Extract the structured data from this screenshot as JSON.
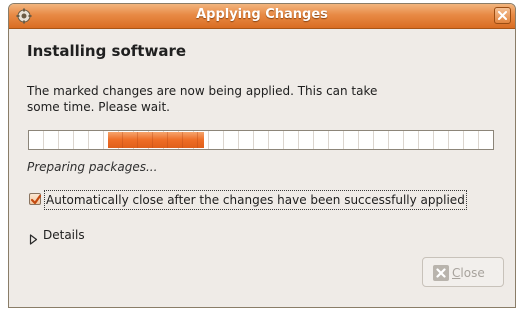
{
  "window": {
    "title": "Applying Changes",
    "accent_color": "#e5792f"
  },
  "heading": "Installing software",
  "description": "The marked changes are now being applied. This can take some time. Please wait.",
  "progress": {
    "indeterminate": true,
    "status_text": "Preparing packages..."
  },
  "auto_close": {
    "checked": true,
    "label": "Automatically close after the changes have been successfully applied"
  },
  "details": {
    "label": "Details",
    "expanded": false,
    "icon": "triangle-right-icon"
  },
  "buttons": {
    "close": {
      "mnemonic": "C",
      "rest": "lose",
      "enabled": false,
      "icon": "close-icon"
    }
  },
  "icons": {
    "window_icon": "package-manager-icon",
    "titlebar_close": "close-icon"
  }
}
